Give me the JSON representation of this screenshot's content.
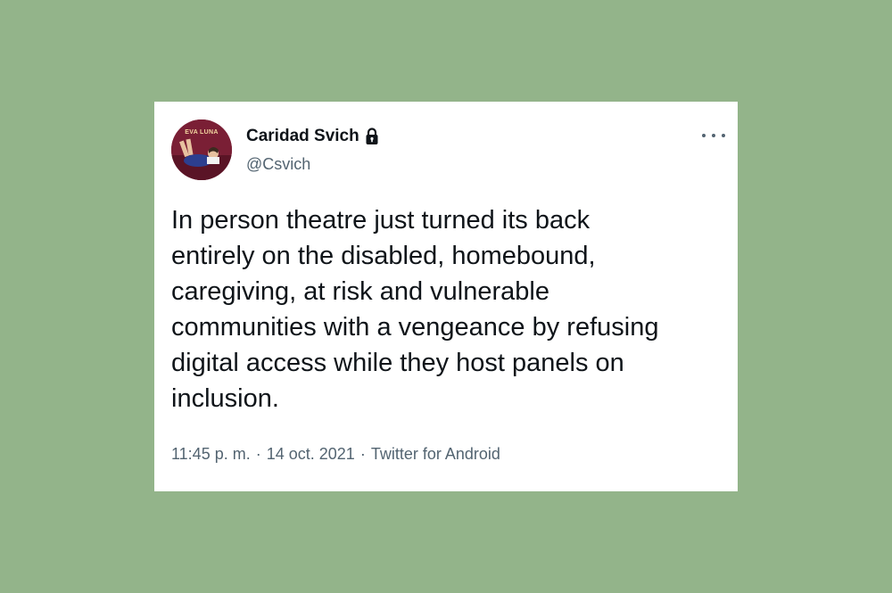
{
  "tweet": {
    "avatar": {
      "text": "EVA LUNA",
      "colors": {
        "background": "#7a1f35",
        "figure": "#2c3f8f",
        "skin": "#e7c1a0"
      }
    },
    "author": {
      "display_name": "Caridad Svich",
      "handle": "@Csvich",
      "protected_icon": "lock-icon"
    },
    "more_icon": "more-options-icon",
    "text": "In person theatre just turned its back\nentirely on the disabled, homebound,\ncaregiving, at risk and vulnerable\ncommunities with a vengeance by refusing\ndigital access while they host panels on\ninclusion.",
    "meta": {
      "time": "11:45 p. m.",
      "separator": "·",
      "date": "14 oct. 2021",
      "source": "Twitter for Android"
    }
  },
  "colors": {
    "page_background": "#93b48a",
    "card_background": "#ffffff",
    "primary_text": "#0f1419",
    "secondary_text": "#536471"
  }
}
